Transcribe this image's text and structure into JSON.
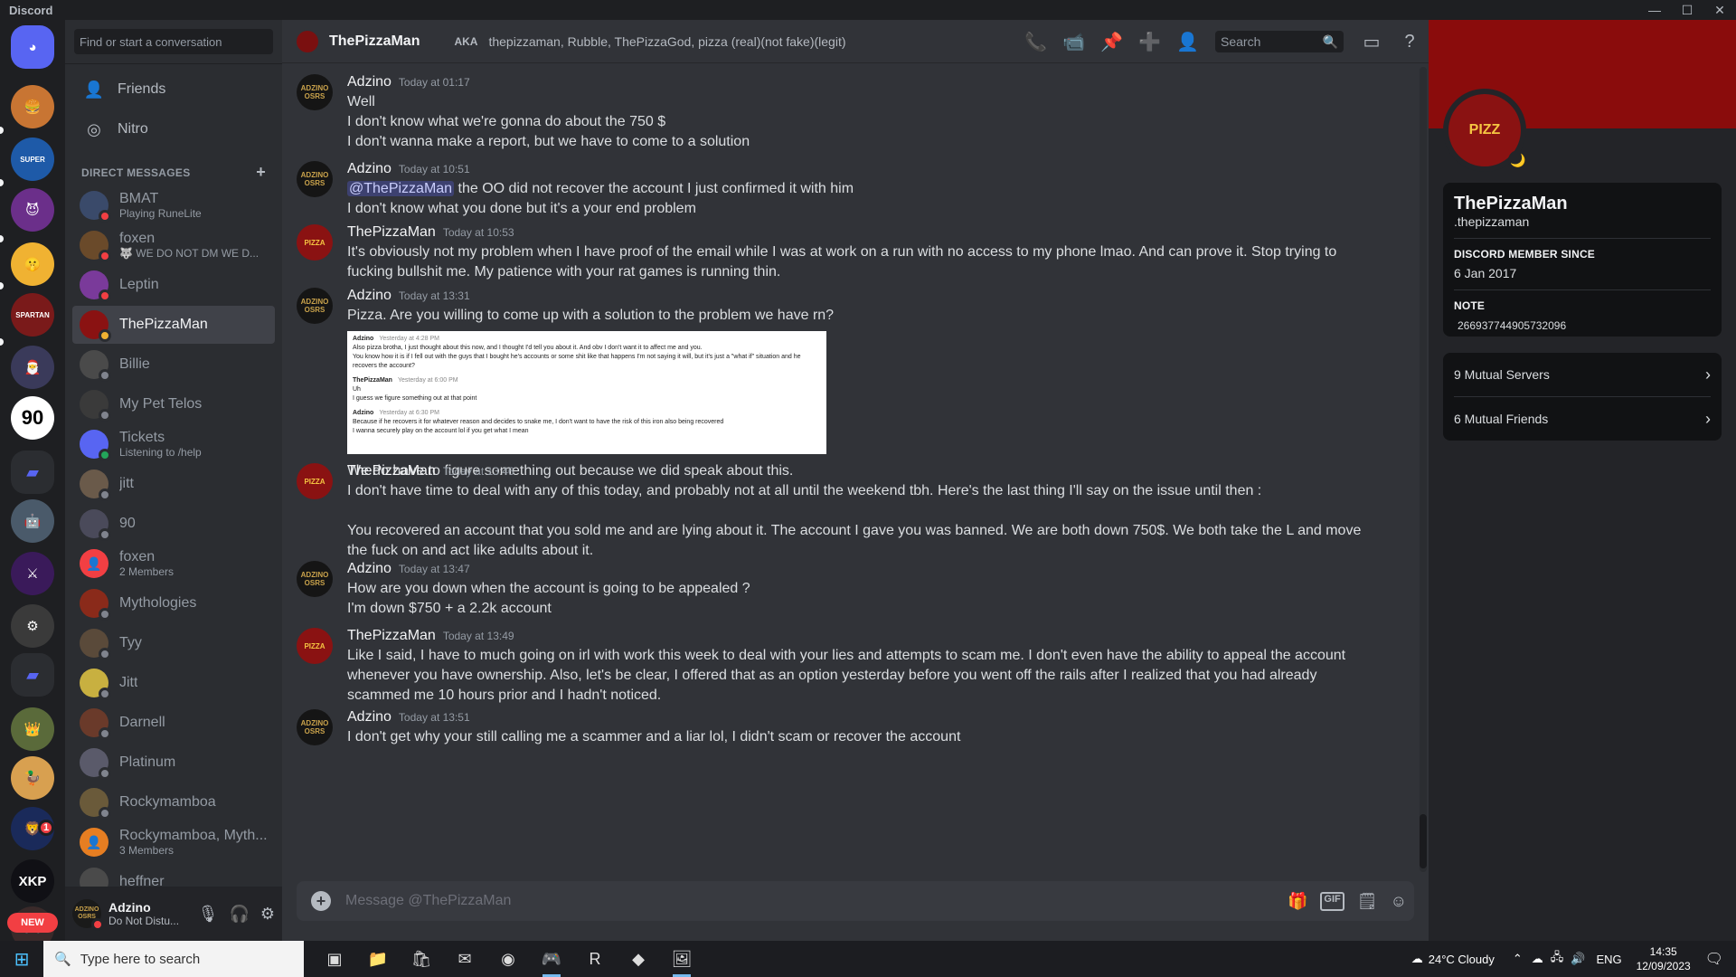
{
  "window": {
    "app_title": "Discord",
    "controls": [
      "—",
      "☐",
      "✕"
    ]
  },
  "guilds": {
    "items": [
      {
        "label": "DM",
        "color": "#5865f2",
        "top": 0
      },
      {
        "label": "🍔",
        "color": "#c87533"
      },
      {
        "label": "SUPER",
        "color": "#1e5aa8"
      },
      {
        "label": "😈",
        "color": "#6b2f8a"
      },
      {
        "label": "🤫",
        "color": "#f0b232"
      },
      {
        "label": "SPARTAN",
        "color": "#7a1a1a"
      },
      {
        "label": "🎅",
        "color": "#3a3a5a"
      },
      {
        "label": "90",
        "color": "#ffffff"
      },
      {
        "label": "📁",
        "color": "#2b2d31"
      },
      {
        "label": "🤖",
        "color": "#4a5a6a"
      },
      {
        "label": "⚔",
        "color": "#3a1a5a"
      },
      {
        "label": "⚙",
        "color": "#3a3a3a"
      },
      {
        "label": "📁",
        "color": "#2b2d31"
      },
      {
        "label": "👑",
        "color": "#5a6a3a"
      },
      {
        "label": "🦆",
        "color": "#d8a050"
      },
      {
        "label": "🦁",
        "color": "#1a2a5a"
      },
      {
        "label": "XKP",
        "color": "#101015"
      },
      {
        "label": "🎮",
        "color": "#3a2a2a"
      }
    ],
    "notification_count": "1",
    "new_label": "NEW"
  },
  "sidebar": {
    "search_placeholder": "Find or start a conversation",
    "friends_label": "Friends",
    "nitro_label": "Nitro",
    "dm_header": "DIRECT MESSAGES",
    "dms": [
      {
        "name": "BMAT",
        "sub": "Playing RuneLite",
        "color": "#3a4a6a",
        "status": "dnd"
      },
      {
        "name": "foxen",
        "sub": "🐺 WE DO NOT DM WE D...",
        "color": "#6a4a2a",
        "status": "dnd"
      },
      {
        "name": "Leptin",
        "sub": "",
        "color": "#7a3a9a",
        "status": "dnd"
      },
      {
        "name": "ThePizzaMan",
        "sub": "",
        "color": "#8a1212",
        "status": "idle"
      },
      {
        "name": "Billie",
        "sub": "",
        "color": "#4a4a4a",
        "status": "off"
      },
      {
        "name": "My Pet Telos",
        "sub": "",
        "color": "#3a3a3a",
        "status": "off"
      },
      {
        "name": "Tickets",
        "sub": "Listening to /help",
        "color": "#5865f2",
        "status": "on"
      },
      {
        "name": "jitt",
        "sub": "",
        "color": "#6a5a4a",
        "status": "off"
      },
      {
        "name": "90",
        "sub": "",
        "color": "#4a4a5a",
        "status": "off"
      },
      {
        "name": "foxen",
        "sub": "2 Members",
        "color": "#f23f43",
        "status": ""
      },
      {
        "name": "Mythologies",
        "sub": "",
        "color": "#8a2a1a",
        "status": "off"
      },
      {
        "name": "Tyy",
        "sub": "",
        "color": "#5a4a3a",
        "status": "off"
      },
      {
        "name": "Jitt",
        "sub": "",
        "color": "#c8b040",
        "status": "off"
      },
      {
        "name": "Darnell",
        "sub": "",
        "color": "#6a3a2a",
        "status": "off"
      },
      {
        "name": "Platinum",
        "sub": "",
        "color": "#5a5a6a",
        "status": "off"
      },
      {
        "name": "Rockymamboa",
        "sub": "",
        "color": "#6a5a3a",
        "status": "off"
      },
      {
        "name": "Rockymamboa, Myth...",
        "sub": "3 Members",
        "color": "#e67e22",
        "status": ""
      },
      {
        "name": "heffner",
        "sub": "",
        "color": "#4a4a4a",
        "status": ""
      }
    ]
  },
  "user_panel": {
    "name": "Adzino",
    "status": "Do Not Distu...",
    "avatar_text": "ADZINO OSRS"
  },
  "chat_header": {
    "name": "ThePizzaMan",
    "aka_label": "AKA",
    "aka_values": "thepizzaman, Rubble, ThePizzaGod, pizza (real)(not fake)(legit)",
    "search_placeholder": "Search"
  },
  "messages": [
    {
      "author": "Adzino",
      "time": "Today at 01:17",
      "avatar": "adz",
      "lines": [
        "Well",
        "I don't know what we're gonna do about the 750 $",
        "I don't wanna make a report, but we have to come to a solution"
      ]
    },
    {
      "author": "Adzino",
      "time": "Today at 10:51",
      "avatar": "adz",
      "mention": "@ThePizzaMan",
      "lines": [
        " the OO did not recover the account I just confirmed it with him",
        "I don't know what you done but it's a your end problem"
      ]
    },
    {
      "author": "ThePizzaMan",
      "time": "Today at 10:53",
      "avatar": "piz",
      "lines": [
        "It's obviously not my problem when I have proof of the email while I was at work on a run with no access to my phone lmao. And can prove it. Stop trying to fucking bullshit me. My patience with your rat games is running thin."
      ]
    },
    {
      "author": "Adzino",
      "time": "Today at 13:31",
      "avatar": "adz",
      "lines": [
        "Pizza. Are you willing to come up with a solution to the problem we have rn?"
      ],
      "after_image": "We do have to figure something out because we did speak about this."
    },
    {
      "author": "ThePizzaMan",
      "time": "Today at 13:46",
      "avatar": "piz",
      "lines": [
        "I don't have time to deal with any of this today, and probably not at all until the weekend tbh. Here's the last thing I'll say on the issue until then :",
        "",
        "You recovered an account that you sold me and are lying about it. The account I gave you was banned. We are both down 750$. We both take the L and move the fuck on and act like adults about it."
      ]
    },
    {
      "author": "Adzino",
      "time": "Today at 13:47",
      "avatar": "adz",
      "lines": [
        "How are you down when the account is going to be appealed ?",
        "I'm down $750 + a 2.2k account"
      ]
    },
    {
      "author": "ThePizzaMan",
      "time": "Today at 13:49",
      "avatar": "piz",
      "lines": [
        "Like I said, I have to much going on irl with work this week to deal with your lies and attempts to scam me. I don't even have the ability to appeal the account whenever you have ownership. Also, let's be clear, I offered that as an option yesterday before you went off the rails after I realized that you had already scammed me 10 hours prior and I hadn't noticed."
      ]
    },
    {
      "author": "Adzino",
      "time": "Today at 13:51",
      "avatar": "adz",
      "lines": [
        "I don't get why your still calling me a scammer and a liar lol, I didn't scam or recover the account"
      ]
    }
  ],
  "embedded_screenshot": {
    "blocks": [
      {
        "name": "Adzino",
        "time": "Yesterday at 4:28 PM",
        "lines": [
          "Also pizza brotha, I just thought about this now, and I thought I'd tell you about it. And obv I don't want it to affect me and you.",
          "You know how it is if I fell out with the guys that I bought he's accounts or some shit like that happens I'm not saying it will, but it's just a \"what if\" situation and he",
          "recovers the account?"
        ]
      },
      {
        "name": "ThePizzaMan",
        "time": "Yesterday at 6:00 PM",
        "lines": [
          "Uh",
          "I guess we figure something out at that point"
        ]
      },
      {
        "name": "Adzino",
        "time": "Yesterday at 6:30 PM",
        "lines": [
          "Because if he recovers it for whatever reason and decides to snake me, I don't want to have the risk of this iron also being recovered",
          "I wanna securely play on the account lol if you get what I mean"
        ]
      }
    ]
  },
  "composer": {
    "placeholder": "Message @ThePizzaMan",
    "gif_label": "GIF"
  },
  "profile": {
    "display_name": "ThePizzaMan",
    "username": ".thepizzaman",
    "avatar_text": "PIZZ",
    "member_since_label": "DISCORD MEMBER SINCE",
    "member_since": "6 Jan 2017",
    "note_label": "NOTE",
    "note": "266937744905732096",
    "mutual_servers": "9 Mutual Servers",
    "mutual_friends": "6 Mutual Friends"
  },
  "taskbar": {
    "search_placeholder": "Type here to search",
    "weather": "24°C  Cloudy",
    "language": "ENG",
    "time": "14:35",
    "date": "12/09/2023"
  }
}
